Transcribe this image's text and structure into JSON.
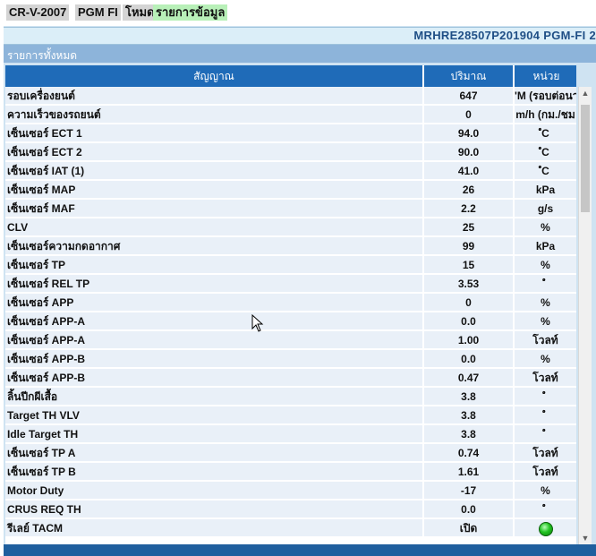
{
  "top_tags": {
    "model": "CR-V-2007",
    "system": "PGM FI",
    "mode_label": "โหมด",
    "mode_value": "รายการข้อมูล"
  },
  "vin_bar": {
    "text": "MRHRE28507P201904  PGM-FI  2"
  },
  "section": {
    "title": "รายการทั้งหมด"
  },
  "table": {
    "headers": {
      "signal": "สัญญาณ",
      "value": "ปริมาณ",
      "unit": "หน่วย"
    },
    "rows": [
      {
        "signal": "รอบเครื่องยนต์",
        "value": "647",
        "unit": "'M (รอบต่อนา"
      },
      {
        "signal": "ความเร็วของรถยนต์",
        "value": "0",
        "unit": "m/h (กม./ชม"
      },
      {
        "signal": "เซ็นเซอร์ ECT 1",
        "value": "94.0",
        "unit": "ํC"
      },
      {
        "signal": "เซ็นเซอร์ ECT 2",
        "value": "90.0",
        "unit": "ํC"
      },
      {
        "signal": "เซ็นเซอร์ IAT (1)",
        "value": "41.0",
        "unit": "ํC"
      },
      {
        "signal": "เซ็นเซอร์ MAP",
        "value": "26",
        "unit": "kPa"
      },
      {
        "signal": "เซ็นเซอร์ MAF",
        "value": "2.2",
        "unit": "g/s"
      },
      {
        "signal": "CLV",
        "value": "25",
        "unit": "%"
      },
      {
        "signal": "เซ็นเซอร์ความกดอากาศ",
        "value": "99",
        "unit": "kPa"
      },
      {
        "signal": "เซ็นเซอร์ TP",
        "value": "15",
        "unit": "%"
      },
      {
        "signal": "เซ็นเซอร์ REL TP",
        "value": "3.53",
        "unit": "ํ"
      },
      {
        "signal": "เซ็นเซอร์ APP",
        "value": "0",
        "unit": "%"
      },
      {
        "signal": "เซ็นเซอร์ APP-A",
        "value": "0.0",
        "unit": "%"
      },
      {
        "signal": "เซ็นเซอร์ APP-A",
        "value": "1.00",
        "unit": "โวลท์"
      },
      {
        "signal": "เซ็นเซอร์ APP-B",
        "value": "0.0",
        "unit": "%"
      },
      {
        "signal": "เซ็นเซอร์ APP-B",
        "value": "0.47",
        "unit": "โวลท์"
      },
      {
        "signal": "ลิ้นปีกผีเสื้อ",
        "value": "3.8",
        "unit": "ํ"
      },
      {
        "signal": "Target TH VLV",
        "value": "3.8",
        "unit": "ํ"
      },
      {
        "signal": "Idle Target TH",
        "value": "3.8",
        "unit": "ํ"
      },
      {
        "signal": "เซ็นเซอร์ TP A",
        "value": "0.74",
        "unit": "โวลท์"
      },
      {
        "signal": "เซ็นเซอร์ TP B",
        "value": "1.61",
        "unit": "โวลท์"
      },
      {
        "signal": "Motor Duty",
        "value": "-17",
        "unit": "%"
      },
      {
        "signal": "CRUS REQ TH",
        "value": "0.0",
        "unit": "ํ"
      },
      {
        "signal": "รีเลย์ TACM",
        "value": "เปิด",
        "unit": "",
        "indicator": "green-led"
      }
    ]
  },
  "colors": {
    "header_bg": "#1f6bb8",
    "row_bg": "#e9f0f8",
    "section_bar": "#8db4da",
    "vin_text": "#1f4f86",
    "led_on": "#22c322"
  }
}
